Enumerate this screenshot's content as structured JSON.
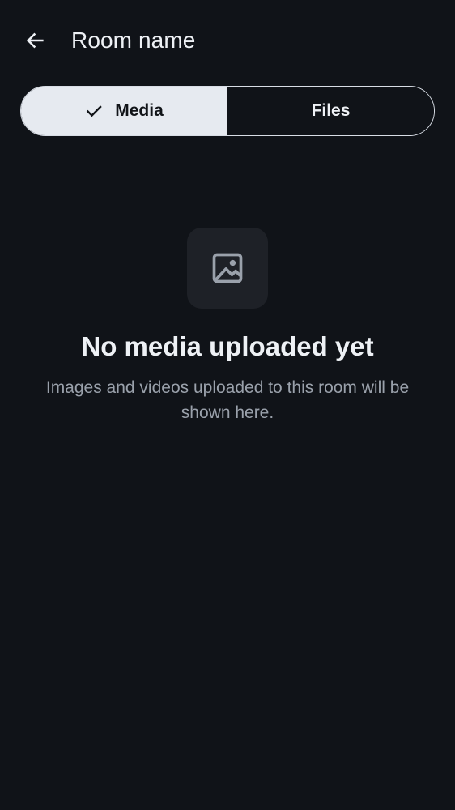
{
  "header": {
    "title": "Room name",
    "back_icon": "arrow-left-icon"
  },
  "tabs": [
    {
      "label": "Media",
      "selected": true,
      "icon": "check-icon"
    },
    {
      "label": "Files",
      "selected": false
    }
  ],
  "empty_state": {
    "icon": "image-icon",
    "title": "No media uploaded yet",
    "description": "Images and videos uploaded to this room will be shown here."
  },
  "colors": {
    "background": "#101318",
    "selected_tab_bg": "#e6eaf0",
    "icon_tile_bg": "#1e2127",
    "muted_text": "#9aa1ab"
  }
}
